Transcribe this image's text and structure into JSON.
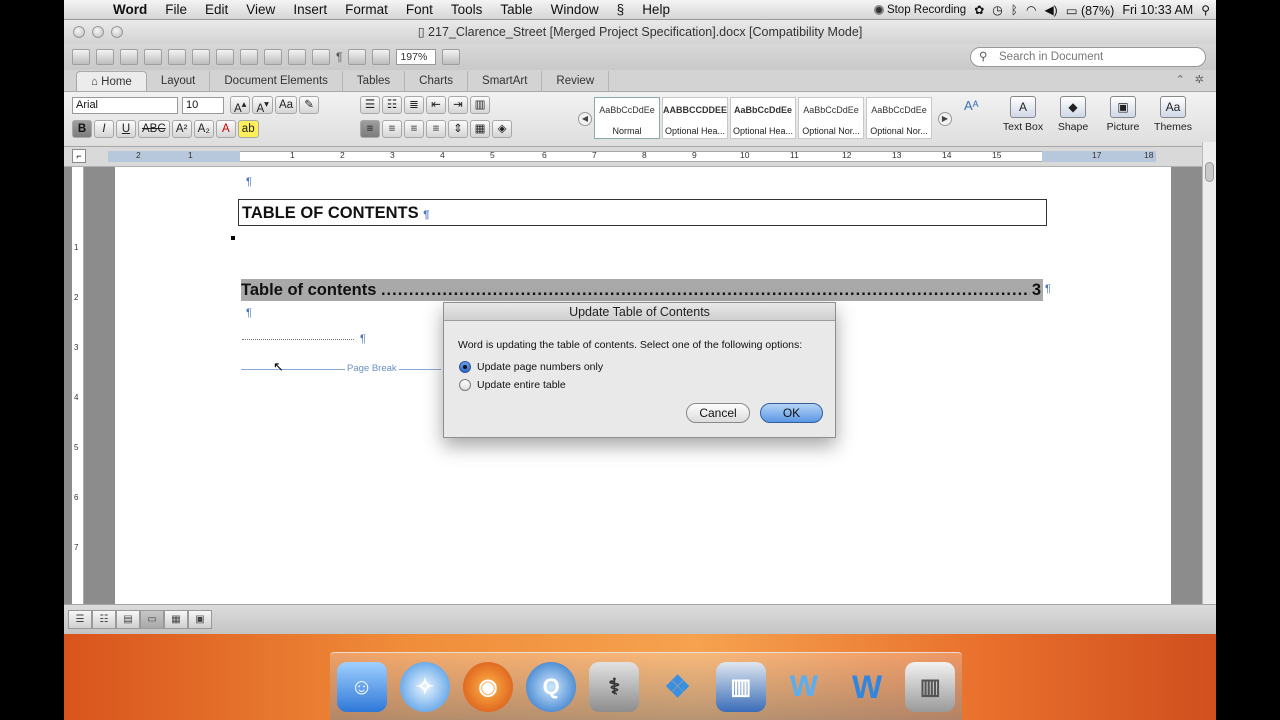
{
  "menubar": {
    "app": "Word",
    "items": [
      "File",
      "Edit",
      "View",
      "Insert",
      "Format",
      "Font",
      "Tools",
      "Table",
      "Window",
      "Help"
    ],
    "stop_recording": "Stop Recording",
    "battery": "(87%)",
    "clock": "Fri 10:33 AM"
  },
  "window": {
    "title": "217_Clarence_Street [Merged Project Specification].docx [Compatibility Mode]",
    "zoom": "197%",
    "search_placeholder": "Search in Document"
  },
  "ribbon_tabs": [
    "Home",
    "Layout",
    "Document Elements",
    "Tables",
    "Charts",
    "SmartArt",
    "Review"
  ],
  "ribbon": {
    "font_name": "Arial",
    "font_size": "10",
    "styles": [
      {
        "sample": "AaBbCcDdEe",
        "name": "Normal"
      },
      {
        "sample": "AABBCCDDEE",
        "name": "Optional Hea..."
      },
      {
        "sample": "AaBbCcDdEe",
        "name": "Optional Hea..."
      },
      {
        "sample": "AaBbCcDdEe",
        "name": "Optional Nor..."
      },
      {
        "sample": "AaBbCcDdEe",
        "name": "Optional Nor..."
      }
    ],
    "insert_buttons": [
      "Text Box",
      "Shape",
      "Picture",
      "Themes"
    ]
  },
  "ruler": {
    "numbers": [
      "2",
      "1",
      "1",
      "1",
      "2",
      "3",
      "4",
      "5",
      "6",
      "7",
      "8",
      "9",
      "10",
      "11",
      "12",
      "13",
      "14",
      "15",
      "17",
      "18"
    ]
  },
  "vertical_ruler": [
    "1",
    "2",
    "3",
    "4",
    "5",
    "6",
    "7"
  ],
  "document": {
    "heading_box": "TABLE OF CONTENTS",
    "toc_entry_text": "Table of contents",
    "toc_entry_dots": "......................................................................................................................",
    "toc_entry_page": "3",
    "page_break_label": "Page Break",
    "pilcrow": "¶"
  },
  "dialog": {
    "title": "Update Table of Contents",
    "message": "Word is updating the table of contents.  Select one of the following options:",
    "options": [
      {
        "label": "Update page numbers only",
        "selected": true
      },
      {
        "label": "Update entire table",
        "selected": false
      }
    ],
    "cancel": "Cancel",
    "ok": "OK"
  },
  "dock": {
    "icons": [
      "finder-icon",
      "safari-icon",
      "firefox-icon",
      "quicktime-icon",
      "disk-utility-icon",
      "dropbox-icon",
      "toaster-icon",
      "word-web-icon",
      "word-icon",
      "trash-icon"
    ]
  },
  "colors": {
    "toc_highlight": "#a9a9a9",
    "pilcrow": "#4b77be",
    "ok_button": "#5a97e3",
    "desktop": "#f08d3a"
  }
}
